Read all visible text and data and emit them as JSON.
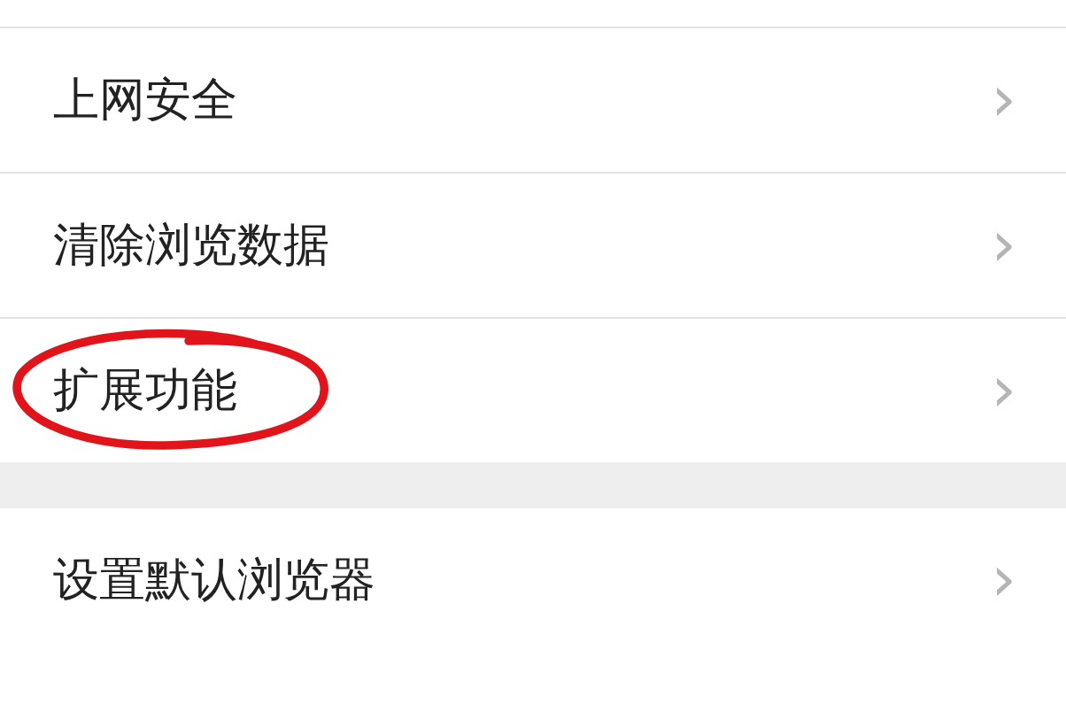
{
  "groups": [
    {
      "items": [
        {
          "label": "上网安全",
          "chevron": "›",
          "circled": false
        },
        {
          "label": "清除浏览数据",
          "chevron": "›",
          "circled": false
        },
        {
          "label": "扩展功能",
          "chevron": "›",
          "circled": true
        }
      ]
    },
    {
      "items": [
        {
          "label": "设置默认浏览器",
          "chevron": "›",
          "circled": false
        }
      ]
    }
  ]
}
